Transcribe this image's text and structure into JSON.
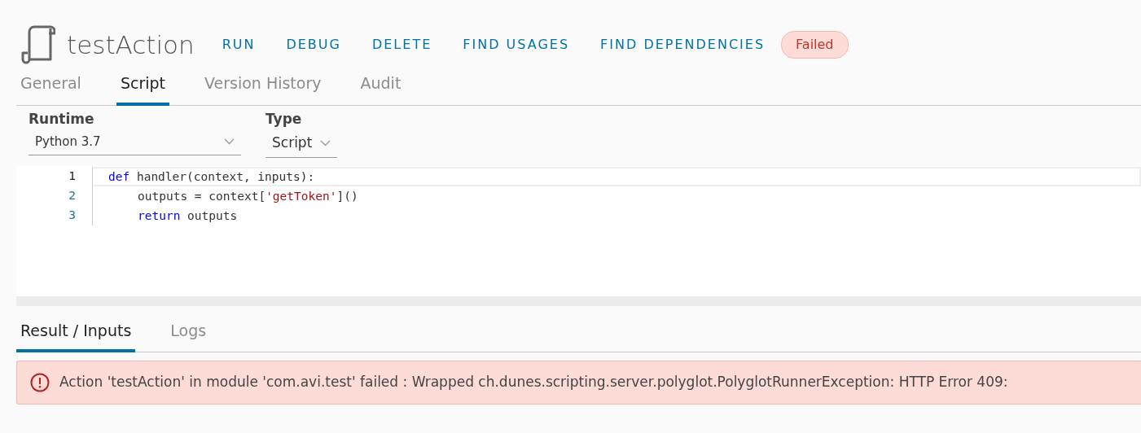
{
  "header": {
    "title": "testAction",
    "actions": [
      "RUN",
      "DEBUG",
      "DELETE",
      "FIND USAGES",
      "FIND DEPENDENCIES"
    ],
    "status": "Failed"
  },
  "tabs": [
    {
      "label": "General",
      "selected": false
    },
    {
      "label": "Script",
      "selected": true
    },
    {
      "label": "Version History",
      "selected": false
    },
    {
      "label": "Audit",
      "selected": false
    }
  ],
  "runtime": {
    "label": "Runtime",
    "value": "Python 3.7"
  },
  "type": {
    "label": "Type",
    "value": "Script"
  },
  "editor": {
    "lines": [
      {
        "number": "1",
        "active": true,
        "indented": false,
        "tokens": [
          {
            "kind": "keyword",
            "text": "def"
          },
          {
            "kind": "plain",
            "text": " handler(context, inputs):"
          }
        ]
      },
      {
        "number": "2",
        "active": false,
        "indented": true,
        "tokens": [
          {
            "kind": "plain",
            "text": "outputs = context["
          },
          {
            "kind": "string",
            "text": "'getToken'"
          },
          {
            "kind": "plain",
            "text": "]()"
          }
        ]
      },
      {
        "number": "3",
        "active": false,
        "indented": true,
        "tokens": [
          {
            "kind": "keyword",
            "text": "return"
          },
          {
            "kind": "plain",
            "text": " outputs"
          }
        ]
      }
    ]
  },
  "result_tabs": [
    {
      "label": "Result / Inputs",
      "selected": true
    },
    {
      "label": "Logs",
      "selected": false
    }
  ],
  "error": "Action 'testAction' in module 'com.avi.test' failed : Wrapped ch.dunes.scripting.server.polyglot.PolyglotRunnerException: HTTP Error 409:"
}
